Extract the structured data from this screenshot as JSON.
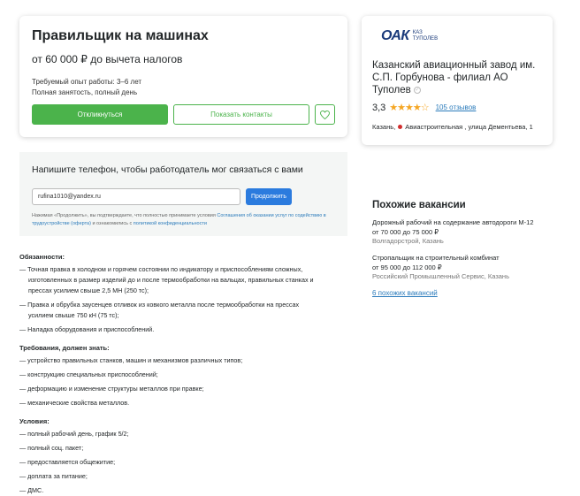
{
  "vacancy": {
    "title": "Правильщик на машинах",
    "salary": "от 60 000 ₽ до вычета налогов",
    "experience": "Требуемый опыт работы: 3–6 лет",
    "employment": "Полная занятость, полный день",
    "respond_label": "Откликнуться",
    "contacts_label": "Показать контакты",
    "heart_icon": "heart-icon"
  },
  "company": {
    "logo_main": "ОАК",
    "logo_sub_1": "КАЗ",
    "logo_sub_2": "ТУПОЛЕВ",
    "name": "Казанский авиационный завод им. С.П. Горбунова - филиал АО Туполев",
    "rating": "3,3",
    "stars": "★★★★☆",
    "reviews": "105 отзывов",
    "city": "Казань,",
    "address": "Авиастроительная , улица Дементьева, 1",
    "metro_color": "#d12d2d"
  },
  "phone": {
    "title": "Напишите телефон, чтобы работодатель мог связаться с вами",
    "email_value": "rufina1010@yandex.ru",
    "continue_label": "Продолжить",
    "consent_text_1": "Нажимая «Продолжить», вы подтверждаете, что полностью принимаете условия",
    "consent_link_1": "Соглашения об оказании услуг по содействию в трудоустройстве (оферта)",
    "consent_text_2": "и ознакомились с",
    "consent_link_2": "политикой конфиденциальности"
  },
  "similar": {
    "heading": "Похожие вакансии",
    "items": [
      {
        "title": "Дорожный рабочий на содержание автодороги М-12",
        "salary": "от 70 000 до 75 000 ₽",
        "company": "Волгадорстрой, Казань"
      },
      {
        "title": "Стропальщик на строительный комбинат",
        "salary": "от 95 000 до 112 000 ₽",
        "company": "Российский Промышленный Сервис, Казань"
      }
    ],
    "more": "6 похожих вакансий"
  },
  "description": {
    "duties_title": "Обязанности:",
    "duties": [
      [
        "— Точная правка в холодном и горячем состоянии по индикатору и приспособлениям сложных,",
        "изготовленных в размер изделий до и после термообработки на вальцах, правильных станках и",
        "прессах усилием свыше 2,5 МН (250 тс);"
      ],
      [
        "— Правка и обрубка заусенцев отливок из ковкого металла после термообработки на прессах",
        "усилием свыше 750 кН (75 тс);"
      ],
      [
        "— Наладка оборудования и приспособлений."
      ]
    ],
    "req_title": "Требования, должен знать:",
    "requirements": [
      "— устройство правильных станков, машин и механизмов различных типов;",
      "— конструкцию специальных приспособлений;",
      "— деформацию и изменение структуры металлов при правке;",
      "— механические свойства металлов."
    ],
    "cond_title": "Условия:",
    "conditions": [
      "— полный рабочий день, график 5/2;",
      "— полный соц. пакет;",
      "— предоставляется общежитие;",
      "— доплата за питание;",
      "— ДМС."
    ]
  }
}
